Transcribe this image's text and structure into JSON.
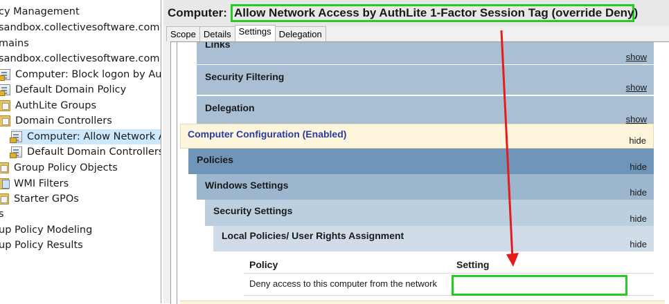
{
  "tree": {
    "items": [
      {
        "label": "cy Management",
        "icon": "none"
      },
      {
        "label": "sandbox.collectivesoftware.com",
        "icon": "none"
      },
      {
        "label": "mains",
        "icon": "none"
      },
      {
        "label": "sandbox.collectivesoftware.com",
        "icon": "none"
      },
      {
        "label": "Computer: Block logon by AuthL",
        "icon": "gpo-link-icon"
      },
      {
        "label": "Default Domain Policy",
        "icon": "gpo-link-icon"
      },
      {
        "label": "AuthLite Groups",
        "icon": "ou-folder-icon"
      },
      {
        "label": "Domain Controllers",
        "icon": "ou-folder-icon"
      },
      {
        "label": "Computer: Allow Network Ac",
        "icon": "gpo-link-icon"
      },
      {
        "label": "Default Domain Controllers I",
        "icon": "gpo-link-icon"
      },
      {
        "label": "Group Policy Objects",
        "icon": "folder-icon"
      },
      {
        "label": "WMI Filters",
        "icon": "wmi-filter-folder-icon"
      },
      {
        "label": "Starter GPOs",
        "icon": "folder-icon"
      },
      {
        "label": "s",
        "icon": "none"
      },
      {
        "label": "up Policy Modeling",
        "icon": "none"
      },
      {
        "label": "up Policy Results",
        "icon": "none"
      }
    ]
  },
  "header": {
    "prefix": "Computer:",
    "title": "Allow Network Access by AuthLite 1-Factor Session Tag (override Deny)"
  },
  "tabs": [
    "Scope",
    "Details",
    "Settings",
    "Delegation"
  ],
  "active_tab": "Settings",
  "report": {
    "links_label": "Links",
    "links_action": "show",
    "security_filtering_label": "Security Filtering",
    "security_filtering_action": "show",
    "delegation_label": "Delegation",
    "delegation_action": "show",
    "computer_config_label": "Computer Configuration (Enabled)",
    "computer_config_action": "hide",
    "policies_label": "Policies",
    "policies_action": "hide",
    "windows_settings_label": "Windows Settings",
    "windows_settings_action": "hide",
    "security_settings_label": "Security Settings",
    "security_settings_action": "hide",
    "local_policies_label": "Local Policies/ User Rights Assignment",
    "local_policies_action": "hide",
    "table": {
      "headers": [
        "Policy",
        "Setting"
      ],
      "rows": [
        {
          "policy": "Deny access to this computer from the network",
          "setting": ""
        }
      ]
    }
  },
  "annotations": {
    "highlight_color": "#22cc22",
    "arrow_color": "#e41c1c"
  }
}
